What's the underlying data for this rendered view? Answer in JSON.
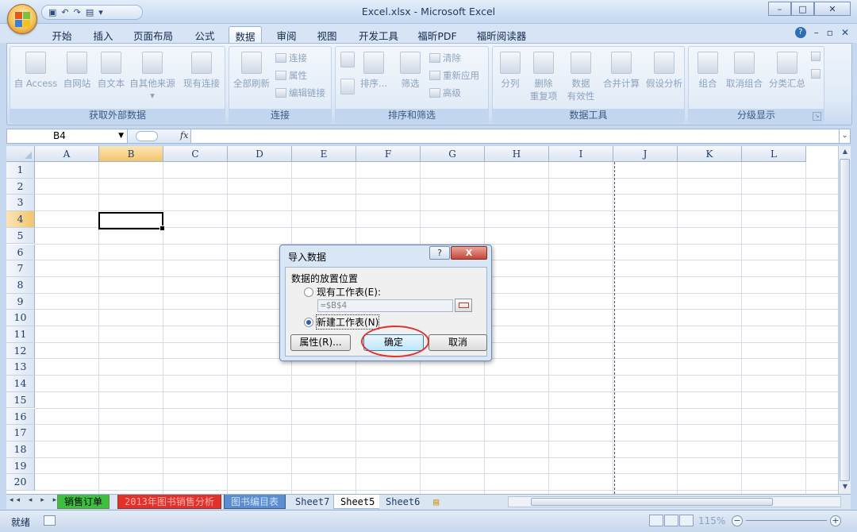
{
  "window": {
    "title": "Excel.xlsx - Microsoft Excel",
    "minimize": "–",
    "restore": "□",
    "close": "✕"
  },
  "ribbon_tabs": [
    "开始",
    "插入",
    "页面布局",
    "公式",
    "数据",
    "审阅",
    "视图",
    "开发工具",
    "福昕PDF",
    "福昕阅读器"
  ],
  "active_tab": "数据",
  "help_controls": {
    "help": "?",
    "minimize": "–",
    "restore": "▫",
    "close": "✕"
  },
  "ribbon": {
    "get_external": {
      "label": "获取外部数据",
      "buttons": [
        "自 Access",
        "自网站",
        "自文本",
        "自其他来源",
        "现有连接"
      ],
      "more_marker": "▾"
    },
    "connections": {
      "label": "连接",
      "refresh_all": "全部刷新",
      "small": [
        "连接",
        "属性",
        "编辑链接"
      ]
    },
    "sort_filter": {
      "label": "排序和筛选",
      "sort": "排序...",
      "filter": "筛选",
      "small": [
        "清除",
        "重新应用",
        "高级"
      ]
    },
    "data_tools": {
      "label": "数据工具",
      "buttons": [
        "分列",
        "删除\n重复项",
        "数据\n有效性",
        "合并计算",
        "假设分析"
      ]
    },
    "outline": {
      "label": "分级显示",
      "buttons": [
        "组合",
        "取消组合",
        "分类汇总"
      ]
    }
  },
  "formula_bar": {
    "name_box": "B4",
    "fx": "fx",
    "value": "",
    "expand": "⌄"
  },
  "columns": [
    "A",
    "B",
    "C",
    "D",
    "E",
    "F",
    "G",
    "H",
    "I",
    "J",
    "K",
    "L"
  ],
  "rows": [
    "1",
    "2",
    "3",
    "4",
    "5",
    "6",
    "7",
    "8",
    "9",
    "10",
    "11",
    "12",
    "13",
    "14",
    "15",
    "16",
    "17",
    "18",
    "19",
    "20"
  ],
  "selected_cell": "B4",
  "sheet_nav": "◂◂ ◂ ▸ ▸▸",
  "sheet_tabs": [
    {
      "name": "销售订单",
      "color": "#3fbf3f"
    },
    {
      "name": "2013年图书销售分析",
      "color": "#e0312a"
    },
    {
      "name": "图书编目表",
      "color": "#5a8ed0"
    },
    {
      "name": "Sheet7",
      "color": ""
    },
    {
      "name": "Sheet5",
      "color": ""
    },
    {
      "name": "Sheet6",
      "color": ""
    }
  ],
  "status_bar": {
    "ready": "就绪",
    "zoom": "115%",
    "zoom_out": "−",
    "zoom_in": "+"
  },
  "dialog": {
    "title": "导入数据",
    "help": "?",
    "close": "X",
    "section_label": "数据的放置位置",
    "option_existing": "现有工作表(E):",
    "option_new": "新建工作表(N)",
    "selected_option": "new",
    "range_value": "=$B$4",
    "properties_button": "属性(R)...",
    "ok_button": "确定",
    "cancel_button": "取消",
    "annotation_color": "#e0312a"
  }
}
